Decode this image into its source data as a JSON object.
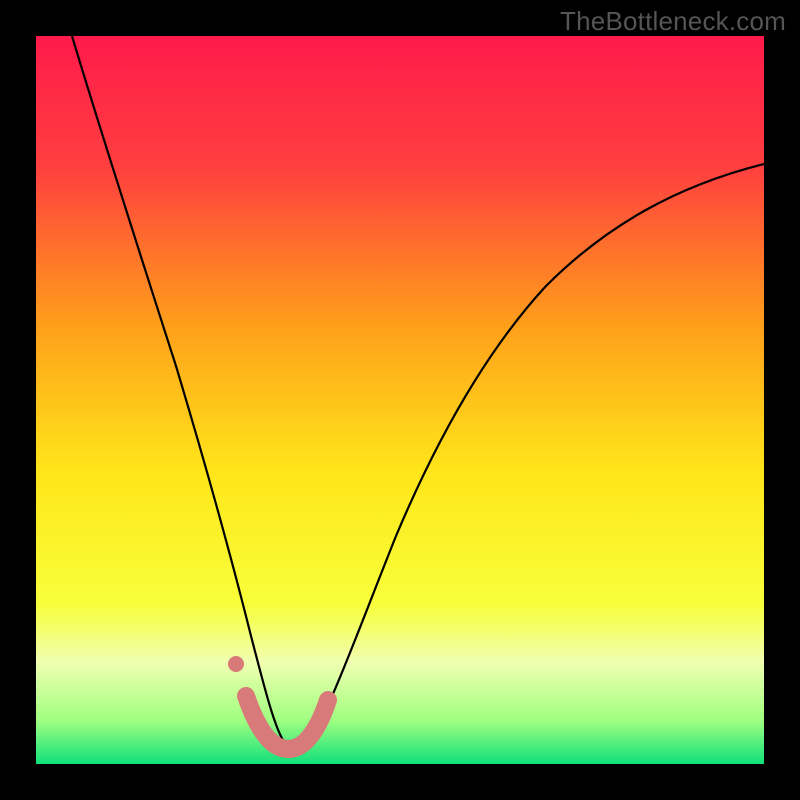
{
  "watermark": "TheBottleneck.com",
  "chart_data": {
    "type": "line",
    "title": "",
    "xlabel": "",
    "ylabel": "",
    "xlim": [
      0,
      100
    ],
    "ylim": [
      0,
      100
    ],
    "background_gradient": {
      "stops": [
        {
          "offset": 0.0,
          "color": "#ff1a4b"
        },
        {
          "offset": 0.18,
          "color": "#ff3f3f"
        },
        {
          "offset": 0.4,
          "color": "#ffa01a"
        },
        {
          "offset": 0.6,
          "color": "#ffe61a"
        },
        {
          "offset": 0.78,
          "color": "#f8ff3a"
        },
        {
          "offset": 0.86,
          "color": "#f0ffb0"
        },
        {
          "offset": 0.94,
          "color": "#a0ff80"
        },
        {
          "offset": 1.0,
          "color": "#10e07a"
        }
      ]
    },
    "series": [
      {
        "name": "bottleneck-curve",
        "x": [
          5,
          10,
          15,
          20,
          25,
          28,
          30,
          32,
          34,
          36,
          38,
          40,
          45,
          50,
          55,
          60,
          70,
          80,
          90,
          100
        ],
        "y": [
          100,
          82,
          65,
          50,
          35,
          24,
          15,
          7,
          3,
          2,
          4,
          10,
          25,
          38,
          48,
          55,
          66,
          74,
          79,
          82
        ]
      }
    ],
    "markers": {
      "name": "highlight-band",
      "color": "#d97a7a",
      "points_x": [
        28.5,
        30.5,
        32.0,
        33.5,
        35.0,
        36.5,
        38.0,
        39.2
      ],
      "points_y": [
        9.0,
        4.5,
        2.5,
        2.0,
        2.2,
        3.0,
        4.8,
        8.5
      ],
      "extra_dot": {
        "x": 27.3,
        "y": 14.0
      }
    }
  }
}
